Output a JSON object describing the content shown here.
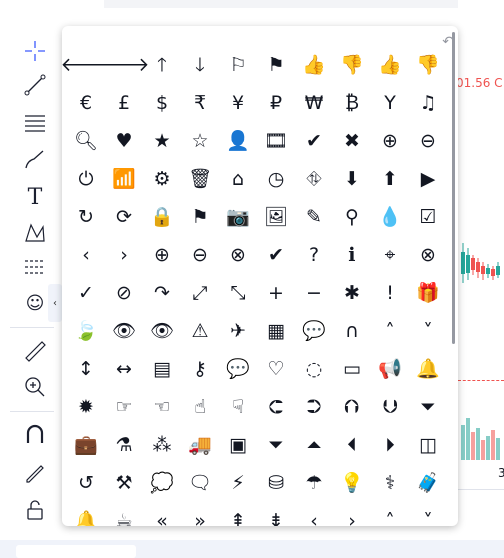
{
  "toolbar": {
    "tools": [
      "crosshair-icon",
      "trend-line-icon",
      "fib-retracement-icon",
      "brush-icon",
      "text-icon",
      "pattern-icon",
      "prediction-icon",
      "emoji-icon",
      "ruler-icon",
      "zoom-in-icon",
      "magnet-icon",
      "lock-drawing-icon",
      "unlock-icon"
    ],
    "collapse_glyph": "‹"
  },
  "chart": {
    "price_label": "01.56 C",
    "axis_value": "3",
    "colors": {
      "down": "#ef5350",
      "up": "#26a69a",
      "text": "#131722"
    }
  },
  "icon_picker": {
    "rows": [
      [
        "arrow-left",
        "arrow-right",
        "arrow-up",
        "arrow-down",
        "flag-outline",
        "checkered-flag",
        "thumbs-up-outline",
        "thumbs-down-outline",
        "thumbs-up",
        "thumbs-down"
      ],
      [
        "euro",
        "pound",
        "dollar",
        "rupee",
        "yen",
        "ruble",
        "won",
        "bitcoin",
        "filter",
        "music"
      ],
      [
        "search",
        "heart",
        "star",
        "star-outline",
        "user",
        "film",
        "check",
        "close",
        "zoom-in",
        "zoom-out"
      ],
      [
        "power",
        "signal",
        "gear",
        "trash",
        "home",
        "clock",
        "road",
        "download-circle",
        "upload-circle",
        "play-circle"
      ],
      [
        "redo",
        "refresh",
        "lock",
        "flag",
        "camera",
        "image",
        "pencil",
        "map-marker",
        "tint",
        "check-square"
      ],
      [
        "chevron-left",
        "chevron-right",
        "plus-circle",
        "minus-circle",
        "times-circle",
        "check-circle",
        "question-circle",
        "info-circle",
        "crosshairs",
        "times-circle-outline"
      ],
      [
        "check-circle-outline",
        "ban",
        "share",
        "expand",
        "compress",
        "plus",
        "minus",
        "asterisk",
        "exclamation-circle",
        "gift"
      ],
      [
        "leaf",
        "eye",
        "eye-slash",
        "warning",
        "plane",
        "calendar",
        "comment",
        "magnet",
        "chevron-up",
        "chevron-down"
      ],
      [
        "arrows-v",
        "arrows-h",
        "bar-chart",
        "key",
        "comments",
        "heart-outline",
        "leaf-outline",
        "credit-card",
        "bullhorn",
        "bell"
      ],
      [
        "certificate",
        "hand-right",
        "hand-left",
        "hand-up",
        "hand-down",
        "arrow-circle-left",
        "arrow-circle-right",
        "arrow-circle-up",
        "arrow-circle-down",
        "funnel"
      ],
      [
        "briefcase",
        "flask",
        "magic",
        "truck",
        "money",
        "caret-down",
        "caret-up",
        "caret-left",
        "caret-right",
        "columns"
      ],
      [
        "undo",
        "gavel",
        "comment-outline",
        "comments-outline",
        "bolt",
        "sitemap",
        "umbrella",
        "lightbulb",
        "stethoscope",
        "suitcase"
      ],
      [
        "bell-solid",
        "coffee",
        "angle-double-left",
        "angle-double-right",
        "angle-double-up",
        "angle-double-down",
        "angle-left",
        "angle-right",
        "angle-up",
        "angle-down"
      ]
    ],
    "glyphs": [
      [
        "🡐",
        "🡒",
        "🡑",
        "🡓",
        "⚐",
        "⚑",
        "👍",
        "👎",
        "👍",
        "👎"
      ],
      [
        "€",
        "£",
        "$",
        "₹",
        "¥",
        "₽",
        "₩",
        "₿",
        "Y",
        "♫"
      ],
      [
        "🔍︎",
        "♥",
        "★",
        "☆",
        "👤",
        "🎞",
        "✔",
        "✖",
        "⊕",
        "⊖"
      ],
      [
        "⏻",
        "📶",
        "⚙",
        "🗑",
        "⌂",
        "◷",
        "⛗",
        "⬇",
        "⬆",
        "▶"
      ],
      [
        "↻",
        "⟳",
        "🔒",
        "⚑",
        "📷",
        "🖼",
        "✎",
        "⚲",
        "💧",
        "☑"
      ],
      [
        "‹",
        "›",
        "⊕",
        "⊖",
        "⊗",
        "✔",
        "?",
        "ℹ",
        "⌖",
        "⊗"
      ],
      [
        "✓",
        "⊘",
        "↷",
        "⤢",
        "⤡",
        "+",
        "−",
        "✱",
        "!",
        "🎁"
      ],
      [
        "🍃",
        "👁",
        "👁",
        "⚠",
        "✈",
        "▦",
        "💬",
        "∩",
        "˄",
        "˅"
      ],
      [
        "↕",
        "↔",
        "▤",
        "⚷",
        "💬",
        "♡",
        "◌",
        "▭",
        "📢",
        "🔔"
      ],
      [
        "✹",
        "☞",
        "☜",
        "☝",
        "☟",
        "⮈",
        "⮊",
        "⮉",
        "⮋",
        "⏷"
      ],
      [
        "💼",
        "⚗",
        "⁂",
        "🚚",
        "▣",
        "⏷",
        "⏶",
        "⏴",
        "⏵",
        "◫"
      ],
      [
        "↺",
        "⚒",
        "💭",
        "🗨",
        "⚡",
        "⛁",
        "☂",
        "💡",
        "⚕",
        "🧳"
      ],
      [
        "🔔",
        "☕",
        "«",
        "»",
        "⇞",
        "⇟",
        "‹",
        "›",
        "˄",
        "˅"
      ]
    ]
  }
}
